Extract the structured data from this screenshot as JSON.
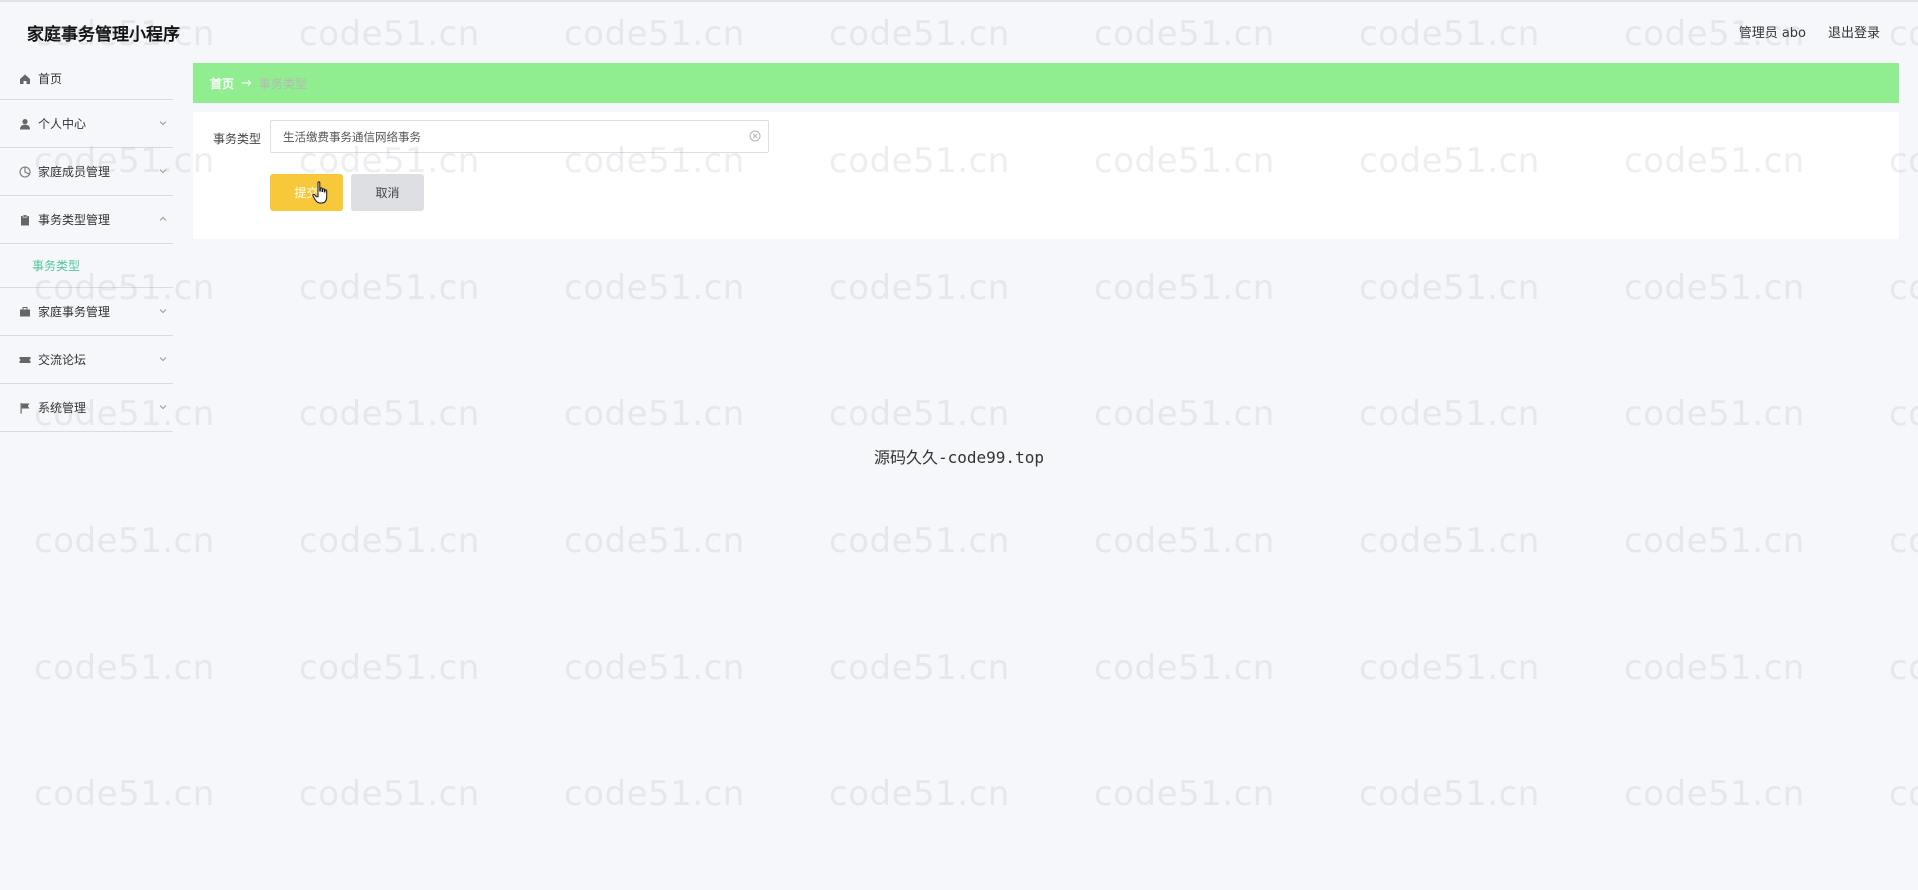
{
  "header": {
    "app_title": "家庭事务管理小程序",
    "admin_label": "管理员 abo",
    "logout": "退出登录"
  },
  "sidebar": {
    "items": [
      {
        "label": "首页",
        "icon": "home-icon"
      },
      {
        "label": "个人中心",
        "icon": "user-icon"
      },
      {
        "label": "家庭成员管理",
        "icon": "members-icon"
      },
      {
        "label": "事务类型管理",
        "icon": "clipboard-icon",
        "expanded": true
      },
      {
        "label": "家庭事务管理",
        "icon": "briefcase-icon"
      },
      {
        "label": "交流论坛",
        "icon": "ticket-icon"
      },
      {
        "label": "系统管理",
        "icon": "flag-icon"
      }
    ],
    "active_sub_item": "事务类型"
  },
  "breadcrumb": {
    "home": "首页",
    "separator": "→",
    "current": "事务类型"
  },
  "form": {
    "field_label": "事务类型",
    "field_value": "生活缴费事务通信网络事务",
    "submit_label": "提交",
    "cancel_label": "取消"
  },
  "footer_text": "源码久久-code99.top",
  "watermark_text": "code51.cn",
  "colors": {
    "breadcrumb_bg": "#90ee90",
    "submit_bg": "#f7c93a",
    "active_sub": "#52c7a0",
    "page_bg": "#f6f7fa"
  }
}
